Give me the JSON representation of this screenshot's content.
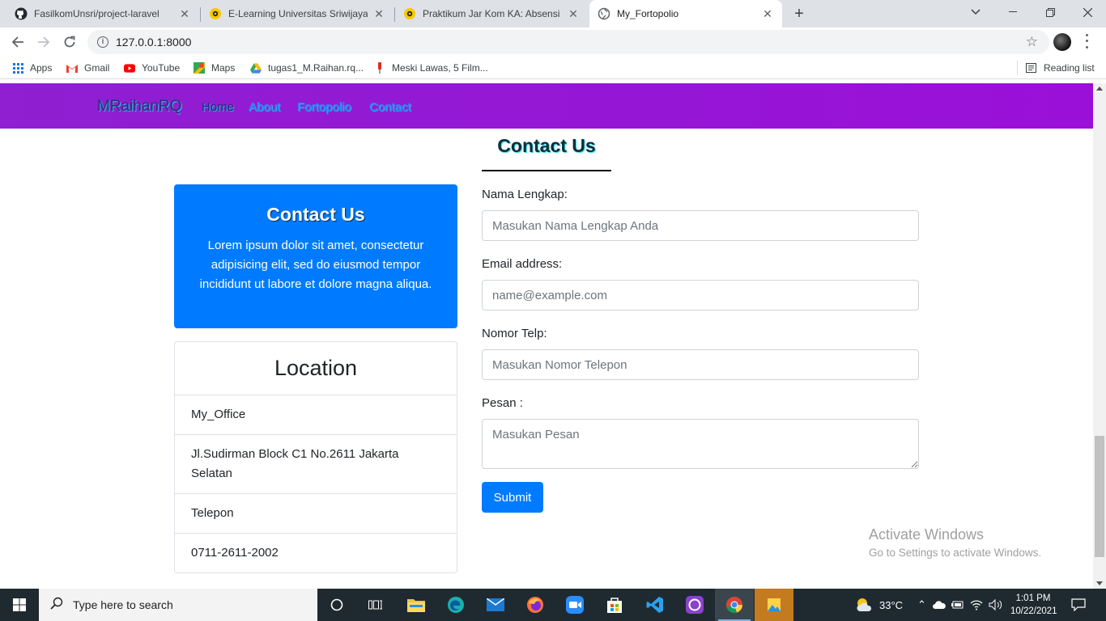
{
  "browser": {
    "tabs": [
      {
        "title": "FasilkomUnsri/project-laravel",
        "icon": "github-icon"
      },
      {
        "title": "E-Learning Universitas Sriwijaya",
        "icon": "moodle-icon"
      },
      {
        "title": "Praktikum Jar Kom KA: Absensi P",
        "icon": "moodle-icon"
      },
      {
        "title": "My_Fortopolio",
        "icon": "globe-icon",
        "active": true
      }
    ],
    "address": "127.0.0.1:8000",
    "bookmarks": [
      {
        "label": "Apps",
        "icon": "apps-grid-icon"
      },
      {
        "label": "Gmail",
        "icon": "gmail-icon"
      },
      {
        "label": "YouTube",
        "icon": "youtube-icon"
      },
      {
        "label": "Maps",
        "icon": "maps-icon"
      },
      {
        "label": "tugas1_M.Raihan.rq...",
        "icon": "drive-icon"
      },
      {
        "label": "Meski Lawas, 5 Film...",
        "icon": "bookmark-pin-icon"
      }
    ],
    "reading_list": "Reading list"
  },
  "site": {
    "brand": "MRaihanRQ",
    "nav": [
      "Home",
      "About",
      "Fortopolio",
      "Contact"
    ],
    "section_title": "Contact Us",
    "contact_card": {
      "title": "Contact Us",
      "text": "Lorem ipsum dolor sit amet, consectetur adipisicing elit, sed do eiusmod tempor incididunt ut labore et dolore magna aliqua."
    },
    "location": {
      "title": "Location",
      "rows": [
        "My_Office",
        "Jl.Sudirman Block C1 No.2611 Jakarta Selatan",
        "Telepon",
        "0711-2611-2002"
      ]
    },
    "form": {
      "name_label": "Nama Lengkap:",
      "name_placeholder": "Masukan Nama Lengkap Anda",
      "email_label": "Email address:",
      "email_placeholder": "name@example.com",
      "phone_label": "Nomor Telp:",
      "phone_placeholder": "Masukan Nomor Telepon",
      "message_label": "Pesan :",
      "message_placeholder": "Masukan Pesan",
      "submit": "Submit"
    }
  },
  "watermark": {
    "line1": "Activate Windows",
    "line2": "Go to Settings to activate Windows."
  },
  "taskbar": {
    "search_placeholder": "Type here to search",
    "temperature": "33°C",
    "time": "1:01 PM",
    "date": "10/22/2021"
  },
  "colors": {
    "navbar": "#9a10d8",
    "primary": "#007bff"
  }
}
